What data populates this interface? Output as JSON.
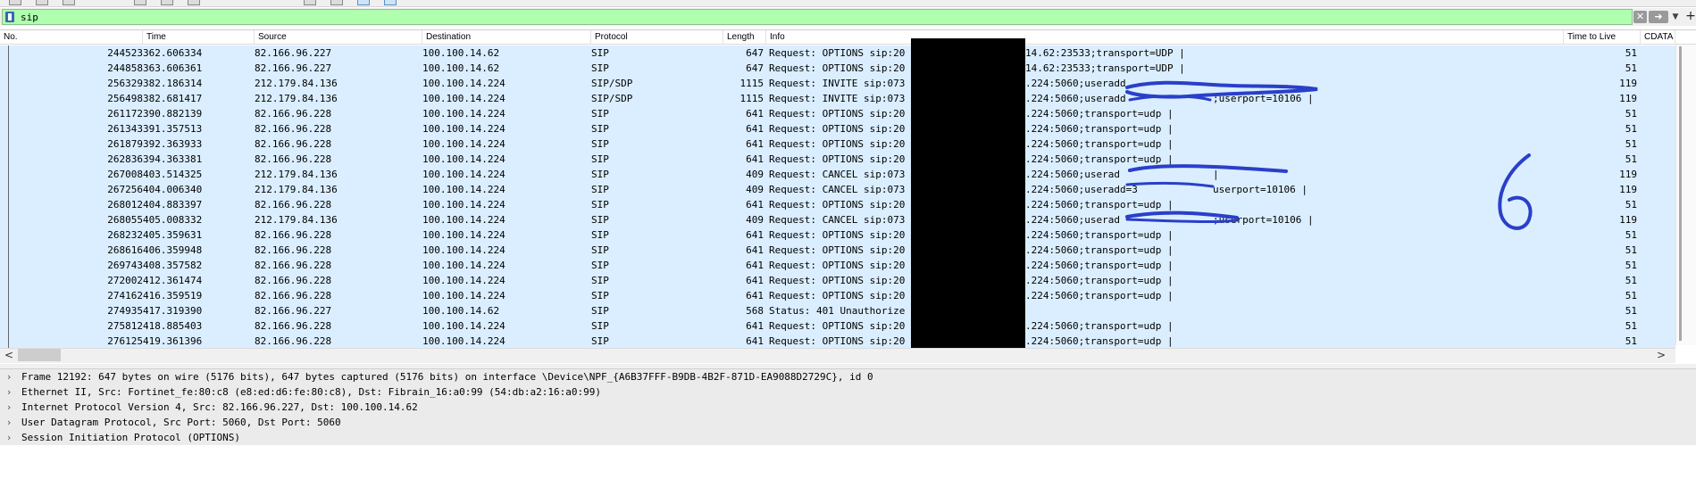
{
  "filter": {
    "value": "sip",
    "clear_icon": "clear-x-icon",
    "apply_icon": "apply-arrow-icon",
    "dropdown_icon": "chevron-down-icon",
    "add_label": "+"
  },
  "columns": {
    "no": "No.",
    "time": "Time",
    "source": "Source",
    "destination": "Destination",
    "protocol": "Protocol",
    "length": "Length",
    "info": "Info",
    "ttl": "Time to Live",
    "cdata": "CDATA"
  },
  "packets": [
    {
      "no": "244523",
      "time": "362.606334",
      "src": "82.166.96.227",
      "dst": "100.100.14.62",
      "proto": "SIP",
      "len": "647",
      "info_left": "Request: OPTIONS sip:20",
      "info_right": "14.62:23533;transport=UDP |",
      "ttl": "51"
    },
    {
      "no": "244858",
      "time": "363.606361",
      "src": "82.166.96.227",
      "dst": "100.100.14.62",
      "proto": "SIP",
      "len": "647",
      "info_left": "Request: OPTIONS sip:20",
      "info_right": "14.62:23533;transport=UDP |",
      "ttl": "51"
    },
    {
      "no": "256329",
      "time": "382.186314",
      "src": "212.179.84.136",
      "dst": "100.100.14.224",
      "proto": "SIP/SDP",
      "len": "1115",
      "info_left": "Request: INVITE sip:073",
      "info_right": ".224:5060;useradd",
      "ttl": "119"
    },
    {
      "no": "256498",
      "time": "382.681417",
      "src": "212.179.84.136",
      "dst": "100.100.14.224",
      "proto": "SIP/SDP",
      "len": "1115",
      "info_left": "Request: INVITE sip:073",
      "info_right": ".224:5060;useradd",
      "info_tail": ";userport=10106 |",
      "ttl": "119"
    },
    {
      "no": "261172",
      "time": "390.882139",
      "src": "82.166.96.228",
      "dst": "100.100.14.224",
      "proto": "SIP",
      "len": "641",
      "info_left": "Request: OPTIONS sip:20",
      "info_right": ".224:5060;transport=udp |",
      "ttl": "51"
    },
    {
      "no": "261343",
      "time": "391.357513",
      "src": "82.166.96.228",
      "dst": "100.100.14.224",
      "proto": "SIP",
      "len": "641",
      "info_left": "Request: OPTIONS sip:20",
      "info_right": ".224:5060;transport=udp |",
      "ttl": "51"
    },
    {
      "no": "261879",
      "time": "392.363933",
      "src": "82.166.96.228",
      "dst": "100.100.14.224",
      "proto": "SIP",
      "len": "641",
      "info_left": "Request: OPTIONS sip:20",
      "info_right": ".224:5060;transport=udp |",
      "ttl": "51"
    },
    {
      "no": "262836",
      "time": "394.363381",
      "src": "82.166.96.228",
      "dst": "100.100.14.224",
      "proto": "SIP",
      "len": "641",
      "info_left": "Request: OPTIONS sip:20",
      "info_right": ".224:5060;transport=udp |",
      "ttl": "51"
    },
    {
      "no": "267008",
      "time": "403.514325",
      "src": "212.179.84.136",
      "dst": "100.100.14.224",
      "proto": "SIP",
      "len": "409",
      "info_left": "Request: CANCEL sip:073",
      "info_right": ".224:5060;userad",
      "info_tail": " |",
      "ttl": "119"
    },
    {
      "no": "267256",
      "time": "404.006340",
      "src": "212.179.84.136",
      "dst": "100.100.14.224",
      "proto": "SIP",
      "len": "409",
      "info_left": "Request: CANCEL sip:073",
      "info_right": ".224:5060;useradd=3",
      "info_tail": "userport=10106 |",
      "ttl": "119"
    },
    {
      "no": "268012",
      "time": "404.883397",
      "src": "82.166.96.228",
      "dst": "100.100.14.224",
      "proto": "SIP",
      "len": "641",
      "info_left": "Request: OPTIONS sip:20",
      "info_right": ".224:5060;transport=udp |",
      "ttl": "51"
    },
    {
      "no": "268055",
      "time": "405.008332",
      "src": "212.179.84.136",
      "dst": "100.100.14.224",
      "proto": "SIP",
      "len": "409",
      "info_left": "Request: CANCEL sip:073",
      "info_right": ".224:5060;userad",
      "info_tail": ";userport=10106 |",
      "ttl": "119"
    },
    {
      "no": "268232",
      "time": "405.359631",
      "src": "82.166.96.228",
      "dst": "100.100.14.224",
      "proto": "SIP",
      "len": "641",
      "info_left": "Request: OPTIONS sip:20",
      "info_right": ".224:5060;transport=udp |",
      "ttl": "51"
    },
    {
      "no": "268616",
      "time": "406.359948",
      "src": "82.166.96.228",
      "dst": "100.100.14.224",
      "proto": "SIP",
      "len": "641",
      "info_left": "Request: OPTIONS sip:20",
      "info_right": ".224:5060;transport=udp |",
      "ttl": "51"
    },
    {
      "no": "269743",
      "time": "408.357582",
      "src": "82.166.96.228",
      "dst": "100.100.14.224",
      "proto": "SIP",
      "len": "641",
      "info_left": "Request: OPTIONS sip:20",
      "info_right": ".224:5060;transport=udp |",
      "ttl": "51"
    },
    {
      "no": "272002",
      "time": "412.361474",
      "src": "82.166.96.228",
      "dst": "100.100.14.224",
      "proto": "SIP",
      "len": "641",
      "info_left": "Request: OPTIONS sip:20",
      "info_right": ".224:5060;transport=udp |",
      "ttl": "51"
    },
    {
      "no": "274162",
      "time": "416.359519",
      "src": "82.166.96.228",
      "dst": "100.100.14.224",
      "proto": "SIP",
      "len": "641",
      "info_left": "Request: OPTIONS sip:20",
      "info_right": ".224:5060;transport=udp |",
      "ttl": "51"
    },
    {
      "no": "274935",
      "time": "417.319390",
      "src": "82.166.96.227",
      "dst": "100.100.14.62",
      "proto": "SIP",
      "len": "568",
      "info_left": "Status: 401 Unauthorize",
      "info_right": "",
      "ttl": "51"
    },
    {
      "no": "275812",
      "time": "418.885403",
      "src": "82.166.96.228",
      "dst": "100.100.14.224",
      "proto": "SIP",
      "len": "641",
      "info_left": "Request: OPTIONS sip:20",
      "info_right": ".224:5060;transport=udp |",
      "ttl": "51"
    },
    {
      "no": "276125",
      "time": "419.361396",
      "src": "82.166.96.228",
      "dst": "100.100.14.224",
      "proto": "SIP",
      "len": "641",
      "info_left": "Request: OPTIONS sip:20",
      "info_right": ".224:5060;transport=udp |",
      "ttl": "51"
    }
  ],
  "annotation": {
    "handwritten": "6",
    "color": "#2a3fc9"
  },
  "details": [
    {
      "icon": "chevron-right-icon",
      "text": "Frame 12192: 647 bytes on wire (5176 bits), 647 bytes captured (5176 bits) on interface \\Device\\NPF_{A6B37FFF-B9DB-4B2F-871D-EA9088D2729C}, id 0"
    },
    {
      "icon": "chevron-right-icon",
      "text": "Ethernet II, Src: Fortinet_fe:80:c8 (e8:ed:d6:fe:80:c8), Dst: Fibrain_16:a0:99 (54:db:a2:16:a0:99)"
    },
    {
      "icon": "chevron-right-icon",
      "text": "Internet Protocol Version 4, Src: 82.166.96.227, Dst: 100.100.14.62"
    },
    {
      "icon": "chevron-right-icon",
      "text": "User Datagram Protocol, Src Port: 5060, Dst Port: 5060"
    },
    {
      "icon": "chevron-right-icon",
      "text": "Session Initiation Protocol (OPTIONS)"
    }
  ],
  "colors": {
    "row_bg": "#daeeff",
    "filter_valid": "#afffaf",
    "details_bg": "#ebebeb",
    "redaction": "#000000"
  },
  "scroll": {
    "left_icon": "chevron-left-icon",
    "right_icon": "chevron-right-icon",
    "left": "<",
    "right": ">"
  }
}
